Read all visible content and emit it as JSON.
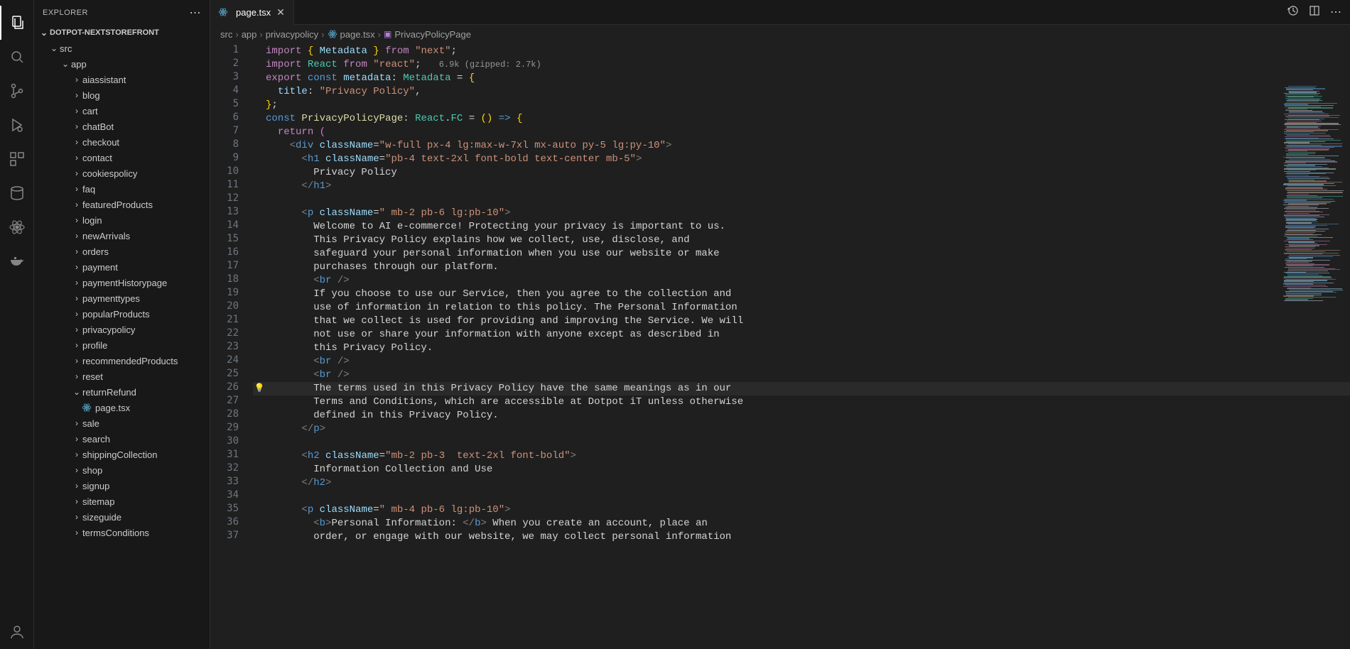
{
  "sidebar": {
    "title": "EXPLORER",
    "project": "DOTPOT-NEXTSTOREFRONT",
    "tree": {
      "src": "src",
      "app": "app",
      "folders": [
        "aiassistant",
        "blog",
        "cart",
        "chatBot",
        "checkout",
        "contact",
        "cookiespolicy",
        "faq",
        "featuredProducts",
        "login",
        "newArrivals",
        "orders",
        "payment",
        "paymentHistorypage",
        "paymenttypes",
        "popularProducts",
        "privacypolicy",
        "profile",
        "recommendedProducts",
        "reset",
        "returnRefund"
      ],
      "openFolder": "returnRefund",
      "openFile": "page.tsx",
      "foldersAfter": [
        "sale",
        "search",
        "shippingCollection",
        "shop",
        "signup",
        "sitemap",
        "sizeguide",
        "termsConditions"
      ]
    }
  },
  "tabs": {
    "active": "page.tsx"
  },
  "breadcrumbs": [
    "src",
    "app",
    "privacypolicy",
    "page.tsx",
    "PrivacyPolicyPage"
  ],
  "editor": {
    "inlayHint": "6.9k (gzipped: 2.7k)",
    "code": {
      "metadataType": "Metadata",
      "next": "next",
      "react": "react",
      "export": "export",
      "const": "const",
      "metadata": "metadata",
      "title": "title",
      "titleVal": "Privacy Policy",
      "component": "PrivacyPolicyPage",
      "reactFC": "React.FC",
      "return": "return",
      "divClass": "w-full px-4 lg:max-w-7xl mx-auto py-5 lg:py-10",
      "h1Class": "pb-4 text-2xl font-bold text-center mb-5",
      "h1Text": "Privacy Policy",
      "p1Class": " mb-2 pb-6 lg:pb-10",
      "p1_l1": "Welcome to AI e-commerce! Protecting your privacy is important to us.",
      "p1_l2": "This Privacy Policy explains how we collect, use, disclose, and",
      "p1_l3": "safeguard your personal information when you use our website or make",
      "p1_l4": "purchases through our platform.",
      "p1_l5": "If you choose to use our Service, then you agree to the collection and",
      "p1_l6": "use of information in relation to this policy. The Personal Information",
      "p1_l7": "that we collect is used for providing and improving the Service. We will",
      "p1_l8": "not use or share your information with anyone except as described in",
      "p1_l9": "this Privacy Policy.",
      "p1_l10": "The terms used in this Privacy Policy have the same meanings as in our",
      "p1_l11": "Terms and Conditions, which are accessible at Dotpot iT unless otherwise",
      "p1_l12": "defined in this Privacy Policy.",
      "h2Class": "mb-2 pb-3  text-2xl font-bold",
      "h2Text": "Information Collection and Use",
      "p2Class": " mb-4 pb-6 lg:pb-10",
      "p2_bold": "Personal Information: ",
      "p2_l1": " When you create an account, place an",
      "p2_l2": "order, or engage with our website, we may collect personal information"
    },
    "lineCount": 37,
    "currentLine": 26
  }
}
